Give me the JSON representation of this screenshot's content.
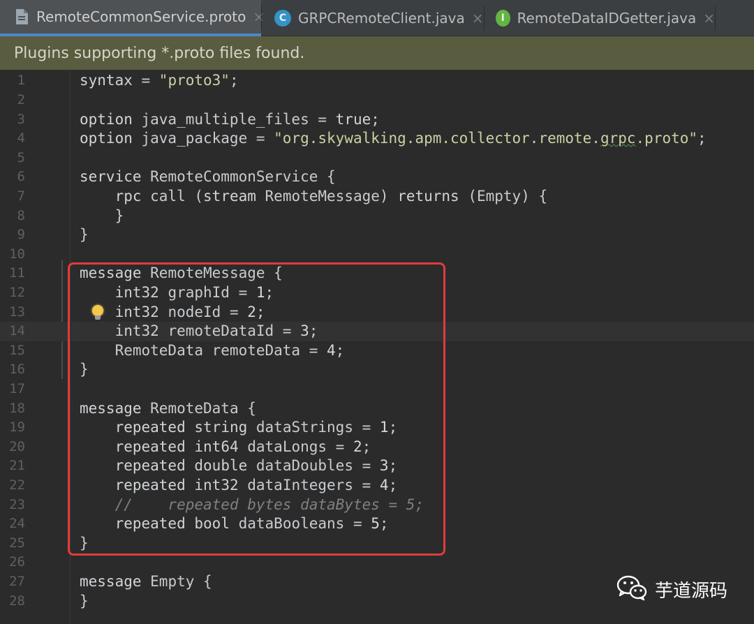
{
  "tabs": [
    {
      "label": "RemoteCommonService.proto",
      "active": true,
      "icon": "proto-file-icon"
    },
    {
      "label": "GRPCRemoteClient.java",
      "active": false,
      "icon": "class-icon",
      "badge": "C",
      "badge_color": "#3592c4"
    },
    {
      "label": "RemoteDataIDGetter.java",
      "active": false,
      "icon": "interface-icon",
      "badge": "I",
      "badge_color": "#62b543"
    }
  ],
  "close_glyph": "×",
  "notification": {
    "text": "Plugins supporting *.proto files found."
  },
  "editor": {
    "language": "proto",
    "current_line": 14,
    "lines": [
      {
        "n": "1",
        "text": "syntax = \"proto3\";"
      },
      {
        "n": "2",
        "text": ""
      },
      {
        "n": "3",
        "text": "option java_multiple_files = true;"
      },
      {
        "n": "4",
        "text": "option java_package = \"org.skywalking.apm.collector.remote.grpc.proto\";"
      },
      {
        "n": "5",
        "text": ""
      },
      {
        "n": "6",
        "text": "service RemoteCommonService {"
      },
      {
        "n": "7",
        "text": "    rpc call (stream RemoteMessage) returns (Empty) {"
      },
      {
        "n": "8",
        "text": "    }"
      },
      {
        "n": "9",
        "text": "}"
      },
      {
        "n": "10",
        "text": ""
      },
      {
        "n": "11",
        "text": "message RemoteMessage {"
      },
      {
        "n": "12",
        "text": "    int32 graphId = 1;"
      },
      {
        "n": "13",
        "text": "    int32 nodeId = 2;"
      },
      {
        "n": "14",
        "text": "    int32 remoteDataId = 3;"
      },
      {
        "n": "15",
        "text": "    RemoteData remoteData = 4;"
      },
      {
        "n": "16",
        "text": "}"
      },
      {
        "n": "17",
        "text": ""
      },
      {
        "n": "18",
        "text": "message RemoteData {"
      },
      {
        "n": "19",
        "text": "    repeated string dataStrings = 1;"
      },
      {
        "n": "20",
        "text": "    repeated int64 dataLongs = 2;"
      },
      {
        "n": "21",
        "text": "    repeated double dataDoubles = 3;"
      },
      {
        "n": "22",
        "text": "    repeated int32 dataIntegers = 4;"
      },
      {
        "n": "23",
        "text": "    //    repeated bytes dataBytes = 5;"
      },
      {
        "n": "24",
        "text": "    repeated bool dataBooleans = 5;"
      },
      {
        "n": "25",
        "text": "}"
      },
      {
        "n": "26",
        "text": ""
      },
      {
        "n": "27",
        "text": "message Empty {"
      },
      {
        "n": "28",
        "text": "}"
      }
    ],
    "lightbulb_line": 13,
    "highlight_color": "#e03c3c"
  },
  "watermark": {
    "text": "芋道源码",
    "icon": "wechat-icon"
  }
}
